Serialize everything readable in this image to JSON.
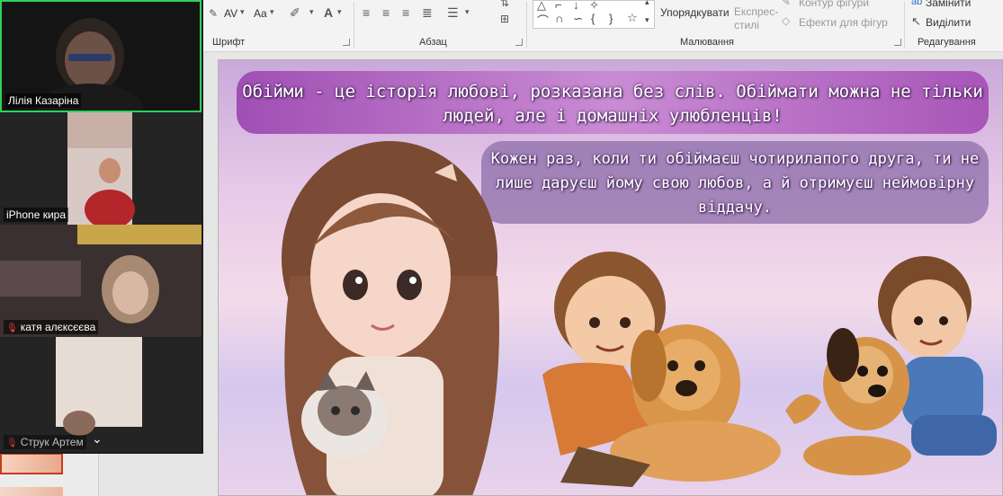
{
  "ribbon": {
    "font_group": "Шрифт",
    "paragraph_group": "Абзац",
    "drawing_group": "Малювання",
    "editing_group": "Редагування",
    "arrange_label": "Упорядкувати",
    "quick_styles_label": "Експрес-стилі",
    "shape_outline_label": "Контур фігури",
    "shape_effects_label": "Ефекти для фігур",
    "replace_label": "Замінити",
    "select_label": "Виділити",
    "aa_label": "Aa",
    "av_label": "AV"
  },
  "video": {
    "participants": [
      {
        "name": "Лілія Казаріна",
        "active": true
      },
      {
        "name": "iPhone кира",
        "active": false
      },
      {
        "name": "катя алєксєєва",
        "muted": true
      },
      {
        "name": "Струк Артем",
        "muted": true
      }
    ]
  },
  "slide": {
    "text1": "Обійми - це історія любові, розказана без слів. Обіймати можна не тільки людей, але і домашніх улюбленців!",
    "text2": "Кожен раз, коли ти обіймаєш чотирилапого друга, ти не лише даруєш йому свою любов, а й отримуєш неймовірну віддачу."
  },
  "colors": {
    "ribbon_bg": "#f3f3f3",
    "active_speaker": "#30d158",
    "bubble_purple": "#a04fb4"
  }
}
